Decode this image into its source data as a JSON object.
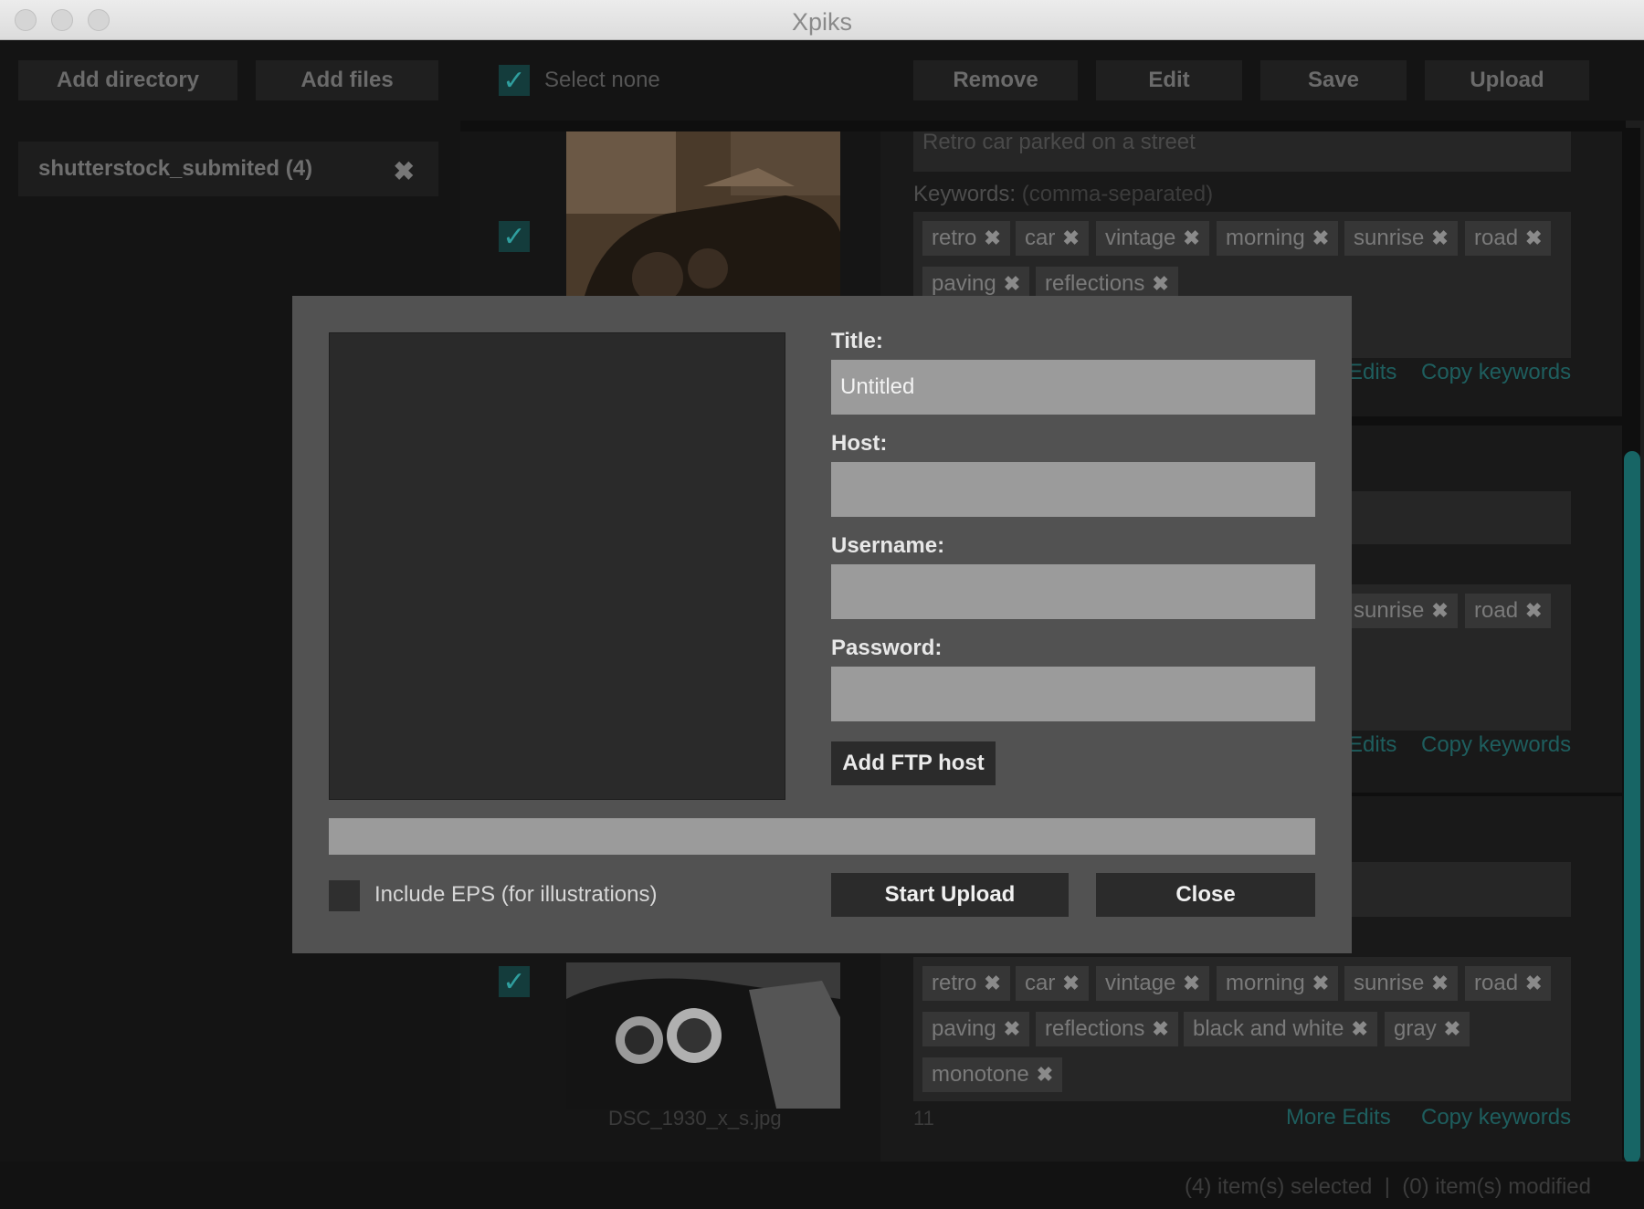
{
  "window": {
    "title": "Xpiks"
  },
  "toolbar": {
    "add_directory": "Add directory",
    "add_files": "Add files",
    "select_none": "Select none",
    "remove": "Remove",
    "edit": "Edit",
    "save": "Save",
    "upload": "Upload"
  },
  "sidebar": {
    "directory": "shutterstock_submited (4)"
  },
  "items": [
    {
      "description": "Retro car parked on a street",
      "keywords_label": "Keywords:",
      "keywords_hint": "(comma-separated)",
      "keywords": [
        "retro",
        "car",
        "vintage",
        "morning",
        "sunrise",
        "road",
        "paving",
        "reflections"
      ],
      "more_edits": "Edits",
      "copy_keywords": "Copy keywords"
    },
    {
      "keywords_visible": [
        "sunrise",
        "road"
      ],
      "more_edits": "Edits",
      "copy_keywords": "Copy keywords"
    },
    {
      "keywords": [
        "retro",
        "car",
        "vintage",
        "morning",
        "sunrise",
        "road",
        "paving",
        "reflections",
        "black and white",
        "gray",
        "monotone"
      ],
      "filename": "DSC_1930_x_s.jpg",
      "keyword_count": "11",
      "more_edits": "More Edits",
      "copy_keywords": "Copy keywords"
    }
  ],
  "status": {
    "text": "(4) item(s) selected  |  (0) item(s) modified"
  },
  "upload_dialog": {
    "title_label": "Title:",
    "title_value": "Untitled",
    "host_label": "Host:",
    "host_value": "",
    "username_label": "Username:",
    "username_value": "",
    "password_label": "Password:",
    "password_value": "",
    "add_ftp_host": "Add FTP host",
    "progress": 0,
    "include_eps": "Include EPS (for illustrations)",
    "include_eps_checked": false,
    "start_upload": "Start Upload",
    "close": "Close"
  },
  "colors": {
    "accent": "#2f9e9e",
    "checkbox_bg": "#143c3c",
    "dialog_bg": "#525252",
    "input_bg": "#9b9b9b"
  }
}
